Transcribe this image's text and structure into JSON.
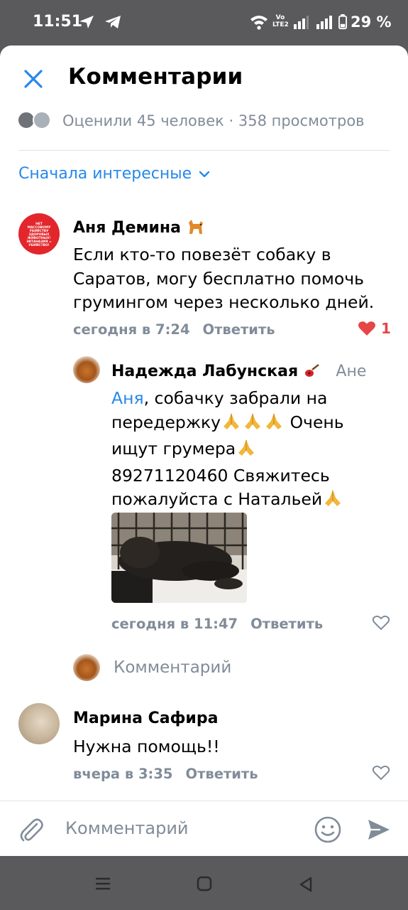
{
  "status": {
    "time": "11:51",
    "lte_label": "Vo LTE2",
    "battery": "29 %"
  },
  "header": {
    "title": "Комментарии"
  },
  "likes_summary": "Оценили 45 человек · 358 просмотров",
  "sort_label": "Сначала интересные",
  "comments": [
    {
      "author": "Аня Демина",
      "author_emoji": "🐕",
      "avatar_text": "НЕТ МАССОВОМУ УБИЙСТВУ ЗДОРОВЫХ ЖИВОТНЫХ! ЭВТАНАЗИЯ = УБИЙСТВО!",
      "text": "Если кто-то повезёт собаку в Саратов, могу бесплатно помочь грумингом через несколько дней.",
      "time": "сегодня в 7:24",
      "reply_label": "Ответить",
      "likes": "1"
    },
    {
      "author": "Надежда Лабунская",
      "author_emoji": "🎸",
      "reply_to": "Ане",
      "mention": "Аня",
      "text_line1": ", собачку забрали на",
      "text_line2": "передержку",
      "text_line2_after": " Очень",
      "text_line3": "ищут грумера",
      "text_line4": "89271120460 Свяжитесь",
      "text_line5": "пожалуйста с Натальей",
      "time": "сегодня в 11:47",
      "reply_label": "Ответить"
    },
    {
      "author": "Марина Сафира",
      "text": "Нужна помощь!!",
      "time": "вчера в 3:35",
      "reply_label": "Ответить"
    }
  ],
  "reply_input_placeholder": "Комментарий",
  "bottom_input_placeholder": "Комментарий",
  "colors": {
    "accent": "#2688eb",
    "secondary_text": "#818c99",
    "like_red": "#e64646"
  }
}
